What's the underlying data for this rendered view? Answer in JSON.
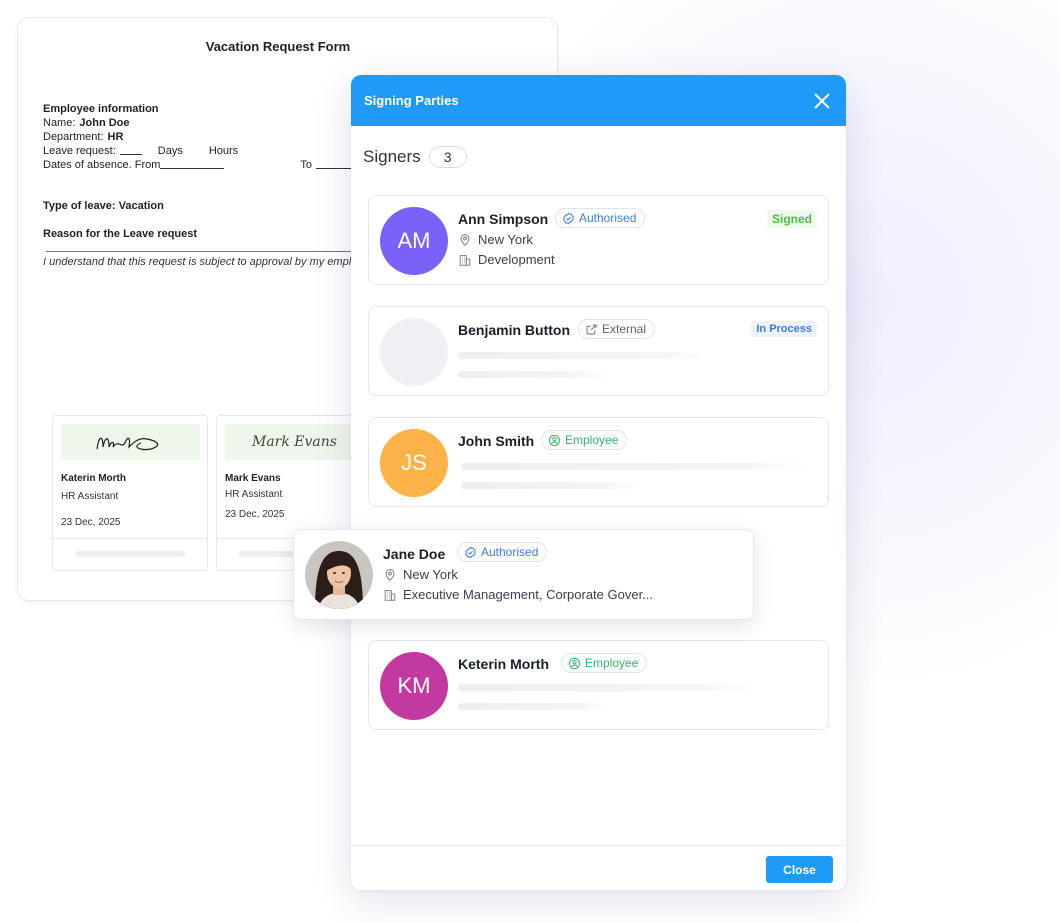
{
  "document": {
    "title": "Vacation Request Form",
    "section_title": "Employee information",
    "name_label": "Name:",
    "name_value": "John Doe",
    "dept_label": "Department:",
    "dept_value": "HR",
    "leave_label": "Leave request:",
    "days_label": "Days",
    "hours_label": "Hours",
    "absence_label": "Dates of absence. From",
    "to_label": "To",
    "type_label": "Type of leave:",
    "type_value": "Vacation",
    "reason_label": "Reason for the Leave request",
    "note": "I understand that this request is subject to approval by my employer",
    "signatures": [
      {
        "name": "Katerin Morth",
        "role": "HR Assistant",
        "date": "23 Dec, 2025",
        "signature_text": "Mark"
      },
      {
        "name": "Mark Evans",
        "role": "HR Assistant",
        "date": "23 Dec, 2025",
        "signature_text": "Mark Evans"
      }
    ]
  },
  "modal": {
    "title": "Signing Parties",
    "signers_label": "Signers",
    "signers_count": "3",
    "close_label": "Close",
    "signers": [
      {
        "initials": "AM",
        "name": "Ann Simpson",
        "tag": "Authorised",
        "status": "Signed",
        "location": "New York",
        "department": "Development",
        "avatar_color": "#7b61f8"
      },
      {
        "initials": "",
        "name": "Benjamin Button",
        "tag": "External",
        "status": "In Process",
        "avatar_color": "#eef0f4"
      },
      {
        "initials": "JS",
        "name": "John Smith",
        "tag": "Employee",
        "avatar_color": "#fdb24a"
      },
      {
        "initials": "KM",
        "name": "Keterin Morth",
        "tag": "Employee",
        "avatar_color": "#c2399f"
      }
    ],
    "floating_signer": {
      "name": "Jane Doe",
      "tag": "Authorised",
      "location": "New York",
      "department": "Executive Management, Corporate Gover..."
    }
  },
  "colors": {
    "accent": "#1f9bf7",
    "signed": "#4cbf47",
    "authorised": "#3e7bdc",
    "employee": "#37b26c"
  }
}
